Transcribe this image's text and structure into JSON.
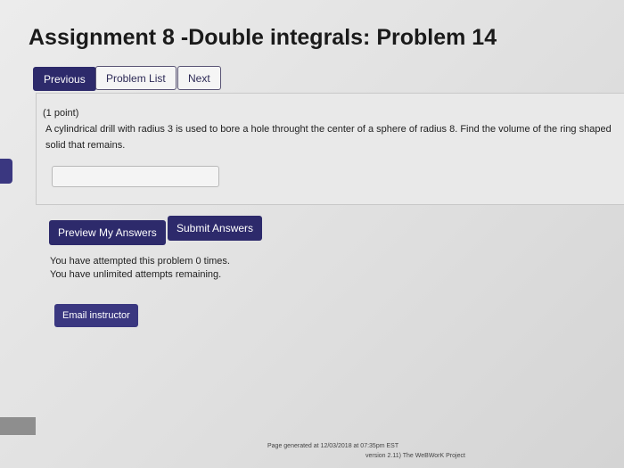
{
  "page": {
    "title": "Assignment 8 -Double integrals: Problem 14"
  },
  "nav": {
    "previous_label": "Previous",
    "problem_list_label": "Problem List",
    "next_label": "Next"
  },
  "problem": {
    "points": "(1 point)",
    "text": "A cylindrical drill with radius 3 is used to bore a hole throught the center of a sphere of radius 8. Find the volume of the ring shaped solid that remains.",
    "answer_value": ""
  },
  "actions": {
    "preview_label": "Preview My Answers",
    "submit_label": "Submit Answers"
  },
  "status": {
    "attempted": "You have attempted this problem 0 times.",
    "remaining": "You have unlimited attempts remaining."
  },
  "email": {
    "label": "Email instructor"
  },
  "footer": {
    "generated": "Page generated at 12/03/2018 at 07:35pm EST",
    "project": "version 2.11) The WeBWorK Project"
  },
  "colors": {
    "primary": "#2d2a6b",
    "background": "#e4e4e4"
  }
}
